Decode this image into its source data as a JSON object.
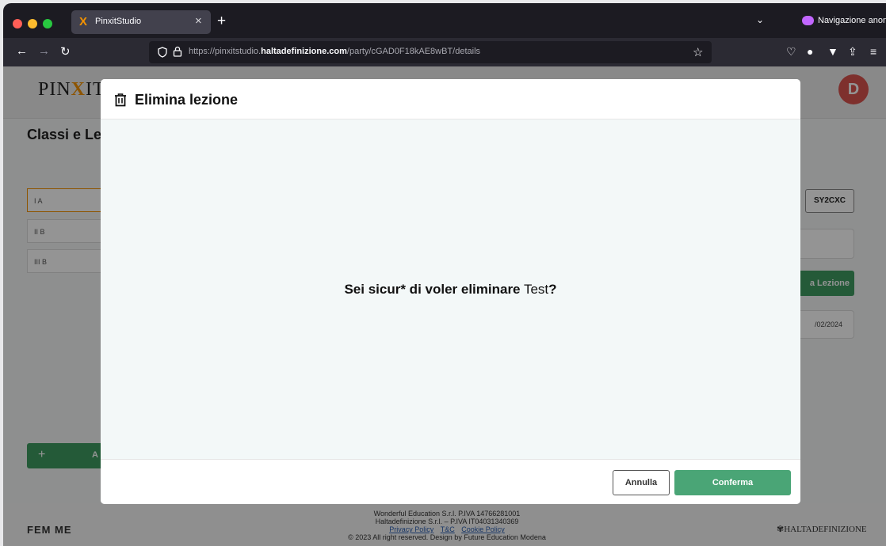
{
  "browser": {
    "tab_title": "PinxitStudio",
    "tab_logo": "X",
    "new_tab_icon": "+",
    "close_icon": "×",
    "private_label": "Navigazione anonima",
    "url_prefix": "https://pinxitstudio.",
    "url_domain": "haltadefinizione.com",
    "url_path": "/party/cGAD0F18kAE8wBT/details",
    "traffic_colors": [
      "#ff5f57",
      "#febc2e",
      "#28c840"
    ]
  },
  "page": {
    "brand_pre": "PIN",
    "brand_x": "X",
    "brand_post": "IT",
    "avatar_letter": "D",
    "title": "Classi e Le",
    "classes": [
      "I A",
      "II B",
      "III B"
    ],
    "add_button": "+       A",
    "code": "SY2CXC",
    "new_lesson_partial": "a Lezione",
    "date_partial": "/02/2024"
  },
  "footer": {
    "fem_logo": "FEM ME",
    "line1": "Wonderful Education S.r.l. P.IVA 14766281001",
    "line2": "Haltadefinizione S.r.l. – P.IVA IT04031340369",
    "privacy": "Privacy Policy",
    "tc": "T&C",
    "cookie": "Cookie Policy",
    "line4": "© 2023 All right reserved. Design by Future Education Modena",
    "hd_logo": "HALTADEFINIZIONE"
  },
  "modal": {
    "title": "Elimina lezione",
    "question_bold": "Sei sicur* di voler eliminare",
    "lesson_name": "Test",
    "question_mark": "?",
    "cancel_label": "Annulla",
    "confirm_label": "Conferma",
    "confirm_color": "#4aa576"
  }
}
